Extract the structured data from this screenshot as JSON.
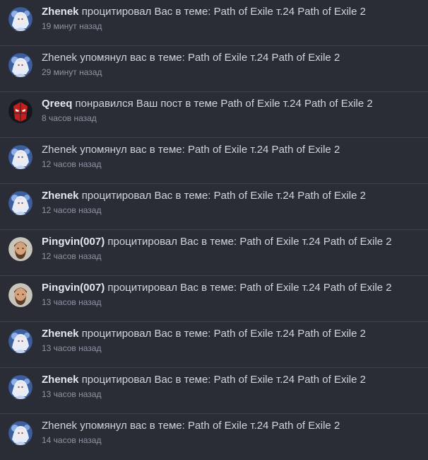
{
  "notifications": [
    {
      "avatar": "anime-girl-avatar",
      "user": "Zhenek",
      "text": "процитировал Вас в теме: Path of Exile т.24 Path of Exile 2",
      "time": "19 минут назад"
    },
    {
      "avatar": "anime-girl-avatar",
      "user": "",
      "text": "Zhenek упомянул вас в теме: Path of Exile т.24 Path of Exile 2",
      "time": "29 минут назад"
    },
    {
      "avatar": "hero-mask-avatar",
      "user": "Qreeq",
      "text": "понравился Ваш пост в теме Path of Exile т.24 Path of Exile 2",
      "time": "8 часов назад"
    },
    {
      "avatar": "anime-girl-avatar",
      "user": "",
      "text": "Zhenek упомянул вас в теме: Path of Exile т.24 Path of Exile 2",
      "time": "12 часов назад"
    },
    {
      "avatar": "anime-girl-avatar",
      "user": "Zhenek",
      "text": "процитировал Вас в теме: Path of Exile т.24 Path of Exile 2",
      "time": "12 часов назад"
    },
    {
      "avatar": "bearded-man-avatar",
      "user": "Pingvin(007)",
      "text": "процитировал Вас в теме: Path of Exile т.24 Path of Exile 2",
      "time": "12 часов назад"
    },
    {
      "avatar": "bearded-man-avatar",
      "user": "Pingvin(007)",
      "text": "процитировал Вас в теме: Path of Exile т.24 Path of Exile 2",
      "time": "13 часов назад"
    },
    {
      "avatar": "anime-girl-avatar",
      "user": "Zhenek",
      "text": "процитировал Вас в теме: Path of Exile т.24 Path of Exile 2",
      "time": "13 часов назад"
    },
    {
      "avatar": "anime-girl-avatar",
      "user": "Zhenek",
      "text": "процитировал Вас в теме: Path of Exile т.24 Path of Exile 2",
      "time": "13 часов назад"
    },
    {
      "avatar": "anime-girl-avatar",
      "user": "",
      "text": "Zhenek упомянул вас в теме: Path of Exile т.24 Path of Exile 2",
      "time": "14 часов назад"
    }
  ]
}
